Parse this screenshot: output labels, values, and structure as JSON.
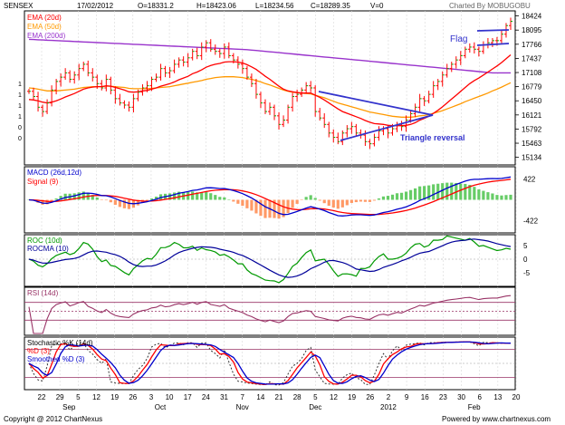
{
  "header": {
    "symbol": "SENSEX",
    "date": "17/02/2012",
    "open": "O=18331.2",
    "high": "H=18423.06",
    "low": "L=18234.56",
    "close": "C=18289.35",
    "volume": "V=0",
    "charted_by": "Charted By MOBUGOBU"
  },
  "footer": {
    "copyright": "Copyright @ 2012 ChartNexus",
    "powered_by": "Powered by www.chartnexus.com"
  },
  "colors": {
    "price_bar": "#ff0000",
    "ema20": "#ff0000",
    "ema50": "#ff9900",
    "ema200": "#9933cc",
    "annotation": "#3333cc",
    "macd": "#0000cc",
    "signal": "#ff0000",
    "hist_pos": "#66cc66",
    "hist_neg": "#ff9966",
    "roc": "#009900",
    "rocma": "#000099",
    "rsi": "#993366",
    "stoch_k": "#333333",
    "stoch_d": "#ff0000",
    "stoch_smooth": "#0000cc",
    "band_line": "#993366"
  },
  "chart_data": [
    {
      "type": "ohlc",
      "panel": "price",
      "legend": [
        "EMA (20d)",
        "EMA (50d)",
        "EMA (200d)"
      ],
      "y_ticks": [
        18424,
        18095,
        17766,
        17437,
        17108,
        16779,
        16450,
        16121,
        15792,
        15463,
        15134
      ],
      "ylim": [
        15000,
        18500
      ],
      "annotations": [
        "Flag",
        "Triangle reversal"
      ],
      "close": [
        16670,
        16550,
        16300,
        16200,
        16400,
        16700,
        16900,
        17000,
        17100,
        16950,
        17050,
        17200,
        17300,
        17100,
        17000,
        16850,
        16750,
        16950,
        16700,
        16500,
        16400,
        16350,
        16300,
        16500,
        16650,
        16750,
        16800,
        16950,
        17000,
        17200,
        17100,
        17150,
        17300,
        17400,
        17350,
        17450,
        17600,
        17500,
        17700,
        17800,
        17650,
        17600,
        17550,
        17700,
        17500,
        17400,
        17300,
        17200,
        17000,
        16850,
        16600,
        16400,
        16200,
        16300,
        16100,
        15900,
        16000,
        16300,
        16550,
        16600,
        16700,
        16800,
        16750,
        16200,
        16050,
        15900,
        15700,
        15600,
        15500,
        15700,
        15800,
        15850,
        15700,
        15650,
        15500,
        15450,
        15600,
        15750,
        15800,
        15700,
        15800,
        15900,
        15850,
        16000,
        16150,
        16300,
        16500,
        16450,
        16600,
        16800,
        16900,
        17050,
        17200,
        17300,
        17400,
        17500,
        17650,
        17700,
        17650,
        17600,
        17750,
        17800,
        17850,
        17850,
        18000,
        18200,
        18300
      ],
      "ema20": [
        16480,
        16470,
        16450,
        16420,
        16400,
        16420,
        16450,
        16490,
        16540,
        16580,
        16620,
        16670,
        16720,
        16750,
        16770,
        16780,
        16780,
        16800,
        16790,
        16760,
        16730,
        16700,
        16660,
        16650,
        16660,
        16680,
        16690,
        16720,
        16750,
        16790,
        16820,
        16850,
        16890,
        16940,
        16980,
        17020,
        17080,
        17120,
        17170,
        17230,
        17270,
        17300,
        17320,
        17350,
        17360,
        17360,
        17350,
        17330,
        17290,
        17240,
        17180,
        17100,
        17020,
        16950,
        16870,
        16790,
        16720,
        16680,
        16660,
        16640,
        16630,
        16630,
        16630,
        16580,
        16530,
        16470,
        16400,
        16330,
        16260,
        16200,
        16160,
        16120,
        16080,
        16040,
        15990,
        15950,
        15920,
        15910,
        15900,
        15880,
        15870,
        15870,
        15870,
        15880,
        15900,
        15940,
        16000,
        16040,
        16090,
        16160,
        16230,
        16310,
        16400,
        16490,
        16580,
        16670,
        16760,
        16850,
        16920,
        16980,
        17050,
        17120,
        17190,
        17260,
        17340,
        17430,
        17520
      ],
      "ema50": [
        16750,
        16740,
        16720,
        16700,
        16680,
        16680,
        16680,
        16690,
        16700,
        16710,
        16720,
        16740,
        16760,
        16770,
        16780,
        16780,
        16780,
        16790,
        16790,
        16780,
        16770,
        16760,
        16740,
        16730,
        16730,
        16730,
        16730,
        16740,
        16750,
        16760,
        16770,
        16780,
        16800,
        16820,
        16840,
        16860,
        16880,
        16900,
        16920,
        16950,
        16970,
        16990,
        17000,
        17010,
        17010,
        17010,
        17000,
        16990,
        16970,
        16950,
        16920,
        16890,
        16850,
        16820,
        16780,
        16740,
        16700,
        16670,
        16650,
        16640,
        16630,
        16620,
        16610,
        16580,
        16550,
        16520,
        16480,
        16440,
        16400,
        16370,
        16340,
        16310,
        16280,
        16250,
        16220,
        16190,
        16170,
        16150,
        16130,
        16110,
        16090,
        16080,
        16070,
        16070,
        16070,
        16080,
        16100,
        16110,
        16130,
        16160,
        16190,
        16220,
        16260,
        16300,
        16340,
        16380,
        16430,
        16470,
        16510,
        16550,
        16590,
        16630,
        16680,
        16720,
        16770,
        16820,
        16870
      ],
      "ema200": [
        17880,
        17875,
        17870,
        17865,
        17860,
        17855,
        17850,
        17845,
        17840,
        17835,
        17830,
        17825,
        17820,
        17815,
        17810,
        17805,
        17800,
        17795,
        17790,
        17785,
        17780,
        17775,
        17770,
        17765,
        17760,
        17755,
        17750,
        17745,
        17740,
        17735,
        17730,
        17725,
        17720,
        17715,
        17710,
        17705,
        17700,
        17695,
        17690,
        17685,
        17680,
        17675,
        17670,
        17665,
        17660,
        17655,
        17650,
        17645,
        17640,
        17630,
        17620,
        17610,
        17600,
        17590,
        17580,
        17570,
        17560,
        17550,
        17540,
        17530,
        17520,
        17510,
        17500,
        17490,
        17480,
        17470,
        17460,
        17450,
        17440,
        17430,
        17420,
        17410,
        17400,
        17390,
        17380,
        17370,
        17360,
        17350,
        17340,
        17330,
        17320,
        17310,
        17300,
        17290,
        17280,
        17270,
        17260,
        17250,
        17240,
        17230,
        17220,
        17210,
        17200,
        17190,
        17180,
        17170,
        17160,
        17150,
        17140,
        17130,
        17120,
        17110,
        17100,
        17100,
        17100,
        17100,
        17100
      ]
    },
    {
      "type": "line",
      "panel": "macd",
      "legend": [
        "MACD (26d,12d)",
        "Signal (9)"
      ],
      "y_ticks": [
        422,
        -422
      ],
      "ylim": [
        -600,
        600
      ]
    },
    {
      "type": "line",
      "panel": "roc",
      "legend": [
        "ROC (10d)",
        "ROCMA (10)"
      ],
      "y_ticks": [
        5,
        0,
        -5
      ],
      "ylim": [
        -9,
        8
      ]
    },
    {
      "type": "line",
      "panel": "rsi",
      "legend": [
        "RSI (14d)"
      ],
      "ylim": [
        0,
        100
      ]
    },
    {
      "type": "line",
      "panel": "stochastic",
      "legend": [
        "Stochastic %K (14d)",
        "%D (3)",
        "Smoothed %D (3)"
      ],
      "ylim": [
        0,
        100
      ]
    },
    {
      "type": "x_axis",
      "day_ticks": [
        "22",
        "29",
        "5",
        "12",
        "19",
        "26",
        "3",
        "10",
        "17",
        "24",
        "31",
        "7",
        "14",
        "21",
        "28",
        "5",
        "12",
        "19",
        "26",
        "2",
        "9",
        "16",
        "23",
        "30",
        "6",
        "13",
        "20"
      ],
      "month_labels": [
        "Sep",
        "Oct",
        "Nov",
        "Dec",
        "2012",
        "Feb"
      ]
    }
  ]
}
